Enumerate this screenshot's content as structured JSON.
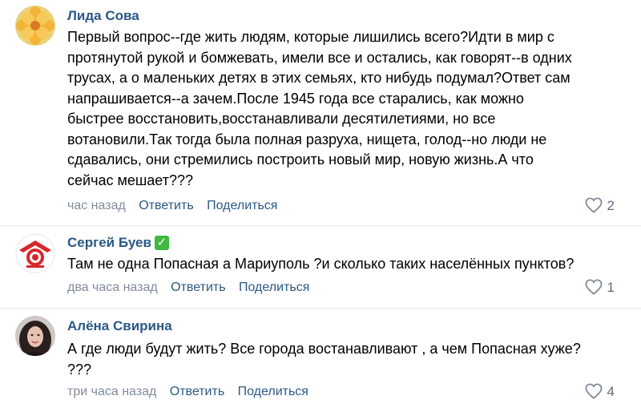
{
  "comments": [
    {
      "author": "Лида Сова",
      "verified": false,
      "lines": [
        "Первый вопрос--где жить людям, которые лишились всего?Идти в мир с",
        "протянутой рукой и бомжевать, имели все и остались, как говорят--в одних",
        "трусах, а о маленьких детях в этих семьях, кто нибудь подумал?Ответ сам",
        "напрашивается--а зачем.После 1945 года все старались, как можно",
        "быстрее восстановить,восстанавливали десятилетиями, но все",
        "вотановили.Так тогда была полная разруха, нищета, голод--но люди не",
        "сдавались, они стремились построить новый мир, новую жизнь.А что",
        "сейчас мешает???"
      ],
      "time": "час назад",
      "reply_label": "Ответить",
      "share_label": "Поделиться",
      "likes": "2"
    },
    {
      "author": "Сергей Буев",
      "verified": true,
      "lines": [
        "Там не одна Попасная а Мариуполь ?и сколько таких населённых пунктов?"
      ],
      "time": "два часа назад",
      "reply_label": "Ответить",
      "share_label": "Поделиться",
      "likes": "1"
    },
    {
      "author": "Алёна Свирина",
      "verified": false,
      "lines": [
        "А где люди будут жить? Все города востанавливают , а чем Попасная хуже?",
        "???"
      ],
      "time": "три часа назад",
      "reply_label": "Ответить",
      "share_label": "Поделиться",
      "likes": "4"
    }
  ],
  "icons": {
    "like": "heart-icon",
    "verified": "check-icon"
  },
  "colors": {
    "author": "#2a5885",
    "meta": "#818c99",
    "verified": "#3fb93f"
  }
}
